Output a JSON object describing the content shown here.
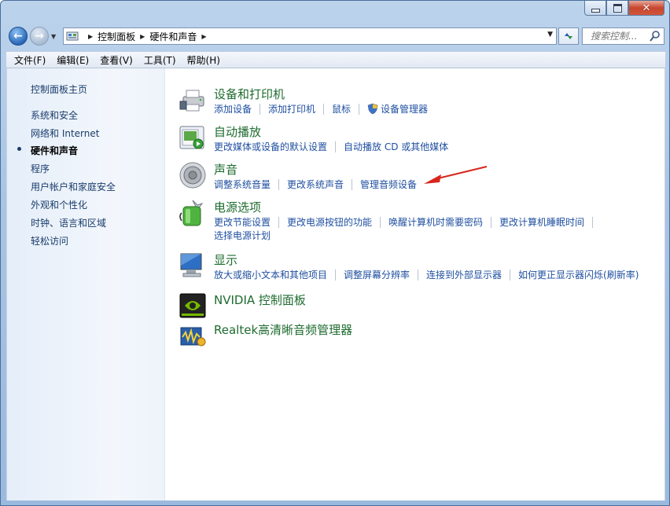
{
  "window": {
    "caption_buttons": [
      "minimize-icon",
      "maximize-icon",
      "close-icon"
    ]
  },
  "nav": {
    "breadcrumbs": [
      "控制面板",
      "硬件和声音"
    ],
    "search_placeholder": "搜索控制...",
    "icons": {
      "back": "back-arrow-icon",
      "forward": "forward-arrow-icon",
      "refresh": "refresh-icon",
      "search": "search-icon"
    }
  },
  "menu": [
    "文件(F)",
    "编辑(E)",
    "查看(V)",
    "工具(T)",
    "帮助(H)"
  ],
  "sidebar": {
    "home": "控制面板主页",
    "items": [
      "系统和安全",
      "网络和 Internet",
      "硬件和声音",
      "程序",
      "用户帐户和家庭安全",
      "外观和个性化",
      "时钟、语言和区域",
      "轻松访问"
    ],
    "selected_index": 2
  },
  "categories": [
    {
      "title": "设备和打印机",
      "icon": "printer-icon",
      "links": [
        "添加设备",
        "添加打印机",
        "鼠标",
        "设备管理器"
      ]
    },
    {
      "title": "自动播放",
      "icon": "autoplay-icon",
      "links": [
        "更改媒体或设备的默认设置",
        "自动播放 CD 或其他媒体"
      ]
    },
    {
      "title": "声音",
      "icon": "speaker-icon",
      "links": [
        "调整系统音量",
        "更改系统声音",
        "管理音频设备"
      ]
    },
    {
      "title": "电源选项",
      "icon": "battery-icon",
      "links": [
        "更改节能设置",
        "更改电源按钮的功能",
        "唤醒计算机时需要密码",
        "更改计算机睡眠时间"
      ],
      "links_row2": [
        "选择电源计划"
      ]
    },
    {
      "title": "显示",
      "icon": "monitor-icon",
      "links": [
        "放大或缩小文本和其他项目",
        "调整屏幕分辨率",
        "连接到外部显示器",
        "如何更正显示器闪烁(刷新率)"
      ]
    },
    {
      "title": "NVIDIA 控制面板",
      "icon": "nvidia-icon",
      "links": []
    },
    {
      "title": "Realtek高清晰音频管理器",
      "icon": "realtek-icon",
      "links": []
    }
  ],
  "colors": {
    "link": "#1f4fa0",
    "category_title": "#1e6b2f",
    "sidebar_link": "#1a3c6b",
    "annotation_arrow": "#d9261c"
  }
}
